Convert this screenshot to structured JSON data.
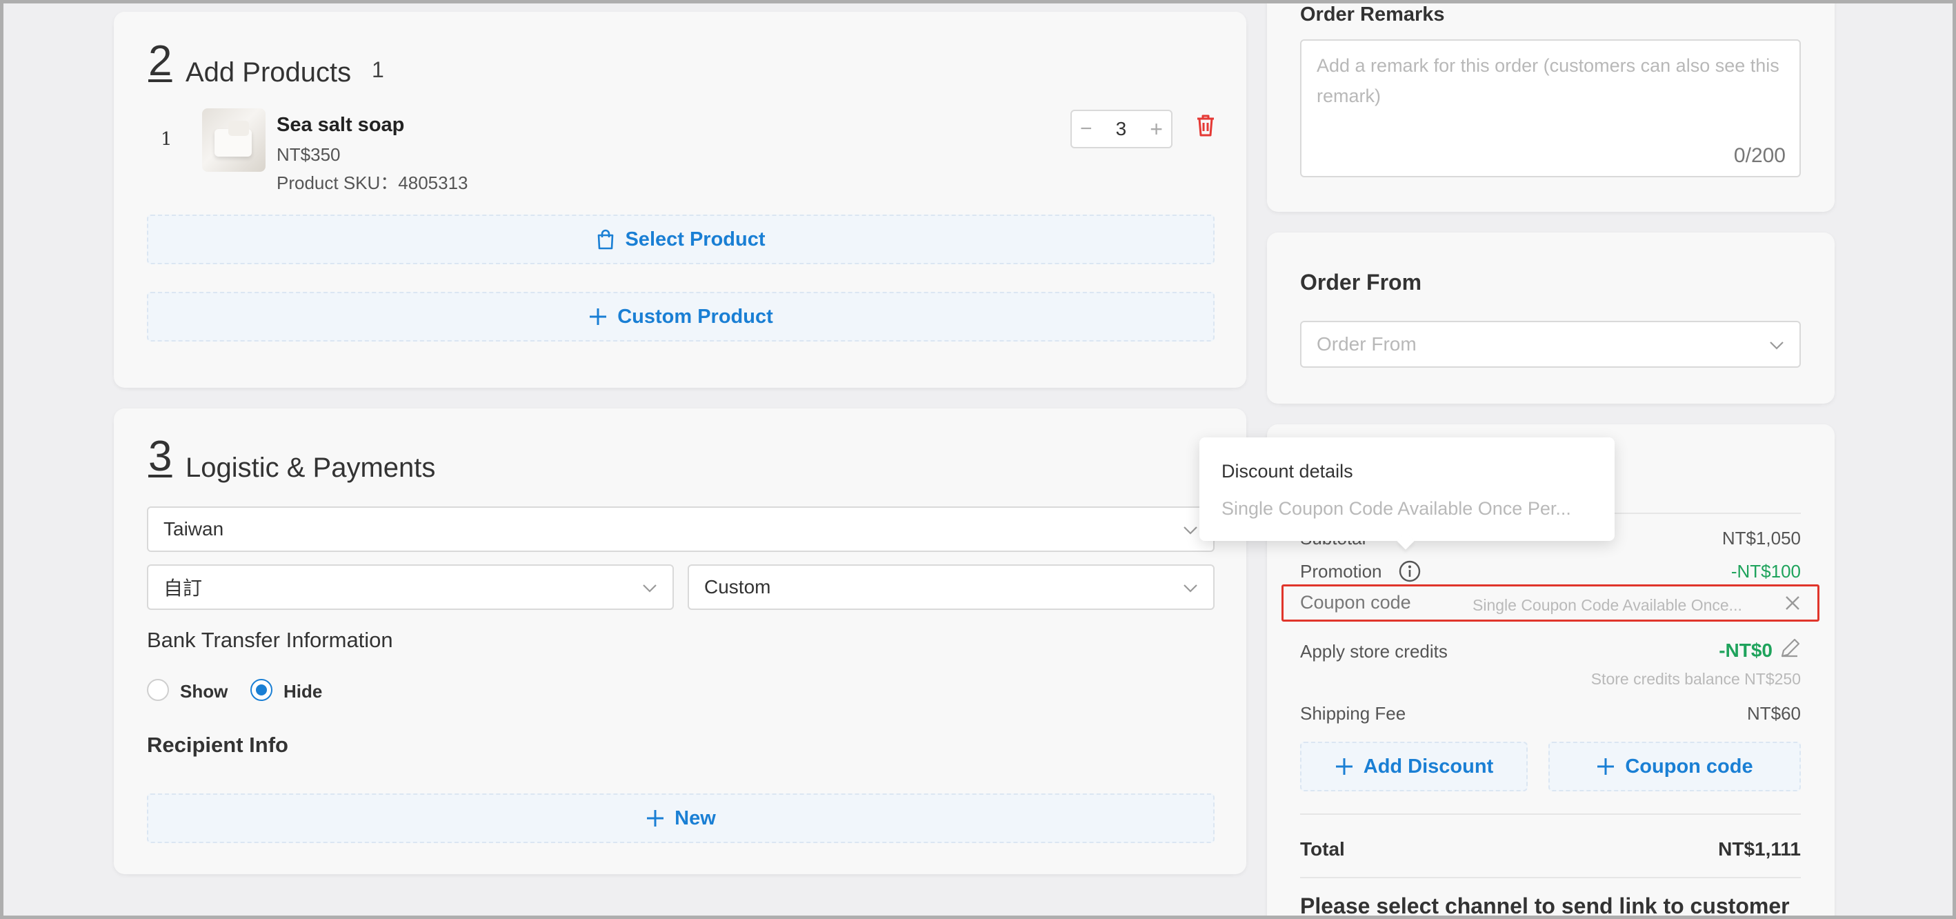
{
  "products": {
    "step_number": "2",
    "title": "Add Products",
    "count": "1",
    "items": [
      {
        "index": "1",
        "name": "Sea salt soap",
        "price": "NT$350",
        "sku": "Product SKU：4805313",
        "quantity": "3",
        "quantity_minus": "−",
        "quantity_plus": "+"
      }
    ],
    "select_product_label": "Select Product",
    "custom_product_label": "Custom Product"
  },
  "logistics": {
    "step_number": "3",
    "title": "Logistic & Payments",
    "country_value": "Taiwan",
    "delivery_value": "自訂",
    "payment_value": "Custom",
    "bank_transfer_title": "Bank Transfer Information",
    "radio_show_label": "Show",
    "radio_hide_label": "Hide",
    "selected_radio": "Hide",
    "recipient_title": "Recipient Info",
    "new_label": "New"
  },
  "remarks": {
    "title": "Order Remarks",
    "placeholder": "Add a remark for this order (customers can also see this remark)",
    "counter": "0/200"
  },
  "order_from": {
    "title": "Order From",
    "placeholder": "Order From"
  },
  "tooltip": {
    "title": "Discount details",
    "text": "Single Coupon Code Available Once Per..."
  },
  "summary": {
    "subtotal_label": "Subtotal",
    "subtotal_value": "NT$1,050",
    "promotion_label": "Promotion",
    "promotion_value": "-NT$100",
    "coupon_label": "Coupon code",
    "coupon_text": "Single Coupon Code Available Once...",
    "store_credits_label": "Apply store credits",
    "store_credits_value": "-NT$0",
    "store_credits_balance": "Store credits balance NT$250",
    "shipping_label": "Shipping Fee",
    "shipping_value": "NT$60",
    "add_discount_label": "Add Discount",
    "coupon_button_label": "Coupon code",
    "total_label": "Total",
    "total_value": "NT$1,111",
    "channel_title": "Please select channel to send link to customer"
  },
  "colors": {
    "accent": "#1a7fd4",
    "green": "#1fa35c",
    "delete_red": "#e53935",
    "highlight_border": "#e0352b"
  },
  "icons": [
    "shopping-bag-icon",
    "plus-icon",
    "trash-icon",
    "chevron-down-icon",
    "info-icon",
    "close-icon",
    "pencil-icon"
  ]
}
